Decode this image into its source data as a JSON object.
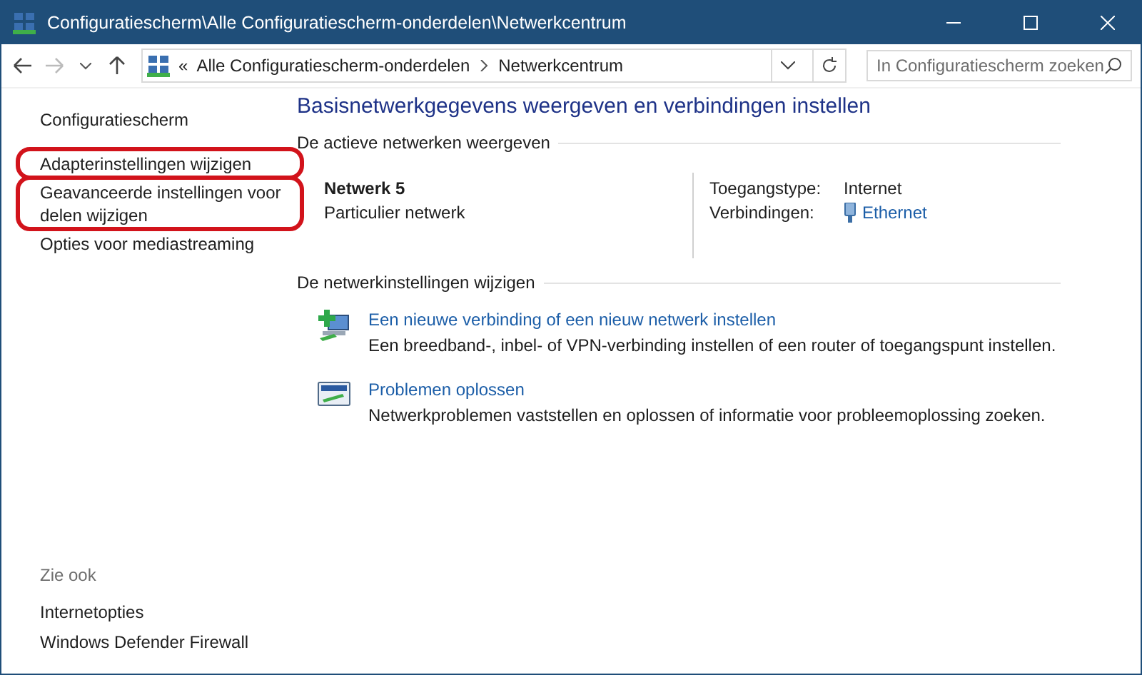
{
  "window": {
    "title": "Configuratiescherm\\Alle Configuratiescherm-onderdelen\\Netwerkcentrum"
  },
  "nav": {
    "overflow": "«",
    "crumbs": [
      "Alle Configuratiescherm-onderdelen",
      "Netwerkcentrum"
    ],
    "search": {
      "placeholder": "In Configuratiescherm zoeken"
    }
  },
  "sidebar": {
    "home": "Configuratiescherm",
    "items": [
      {
        "label": "Adapterinstellingen wijzigen",
        "highlighted": true
      },
      {
        "label": "Geavanceerde instellingen voor delen wijzigen",
        "highlighted": true
      },
      {
        "label": "Opties voor mediastreaming",
        "highlighted": false
      }
    ],
    "see_also": {
      "title": "Zie ook",
      "links": [
        "Internetopties",
        "Windows Defender Firewall"
      ]
    }
  },
  "main": {
    "title": "Basisnetwerkgegevens weergeven en verbindingen instellen",
    "active_section": {
      "title": "De actieve netwerken weergeven",
      "network": {
        "name": "Netwerk  5",
        "category": "Particulier netwerk"
      },
      "details": [
        {
          "label": "Toegangstype:",
          "value": "Internet",
          "kind": "text"
        },
        {
          "label": "Verbindingen:",
          "value": "Ethernet",
          "kind": "link"
        }
      ]
    },
    "change_section": {
      "title": "De netwerkinstellingen wijzigen",
      "tasks": [
        {
          "kind": "new-connection",
          "link": "Een nieuwe verbinding of een nieuw netwerk instellen",
          "description": "Een breedband-, inbel- of VPN-verbinding instellen of een router of toegangspunt instellen."
        },
        {
          "kind": "troubleshoot",
          "link": "Problemen oplossen",
          "description": "Netwerkproblemen vaststellen en oplossen of informatie voor probleemoplossing zoeken."
        }
      ]
    }
  }
}
